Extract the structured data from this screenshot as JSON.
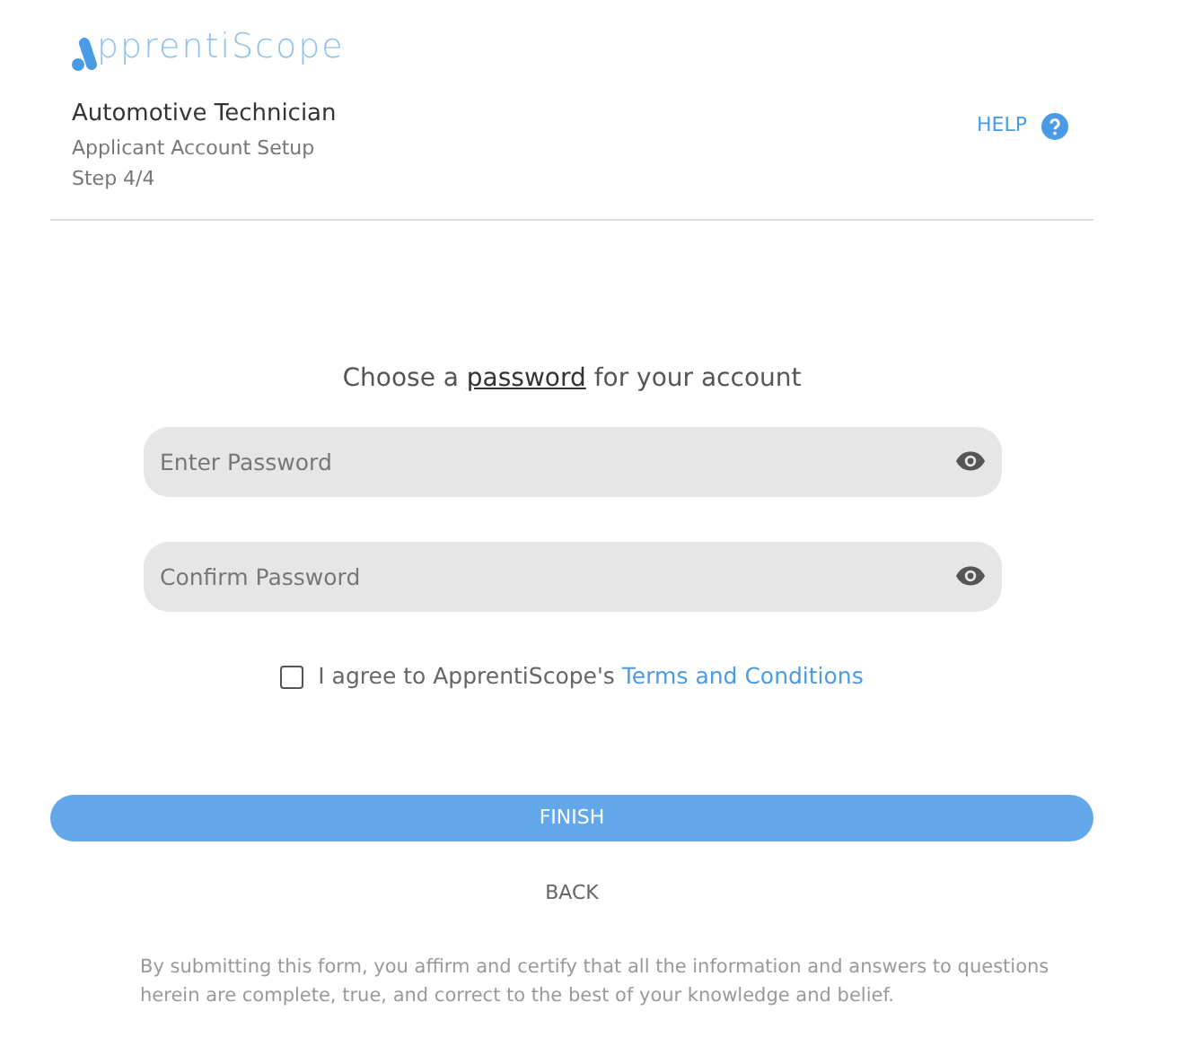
{
  "logo": {
    "text": "pprentiScope"
  },
  "header": {
    "title": "Automotive Technician",
    "subtitle": "Applicant Account Setup",
    "step": "Step 4/4",
    "help": "HELP"
  },
  "prompt": {
    "before": "Choose a ",
    "link": "password",
    "after": " for your account"
  },
  "fields": [
    {
      "placeholder": "Enter Password"
    },
    {
      "placeholder": "Confirm Password"
    }
  ],
  "agreement": {
    "checked": false,
    "text": "I agree to ApprentiScope's ",
    "link": "Terms and Conditions"
  },
  "buttons": {
    "finish": "FINISH",
    "back": "BACK"
  },
  "disclaimer": "By submitting this form, you affirm and certify that all the information and answers to questions herein are complete, true, and correct to the best of your knowledge and belief."
}
